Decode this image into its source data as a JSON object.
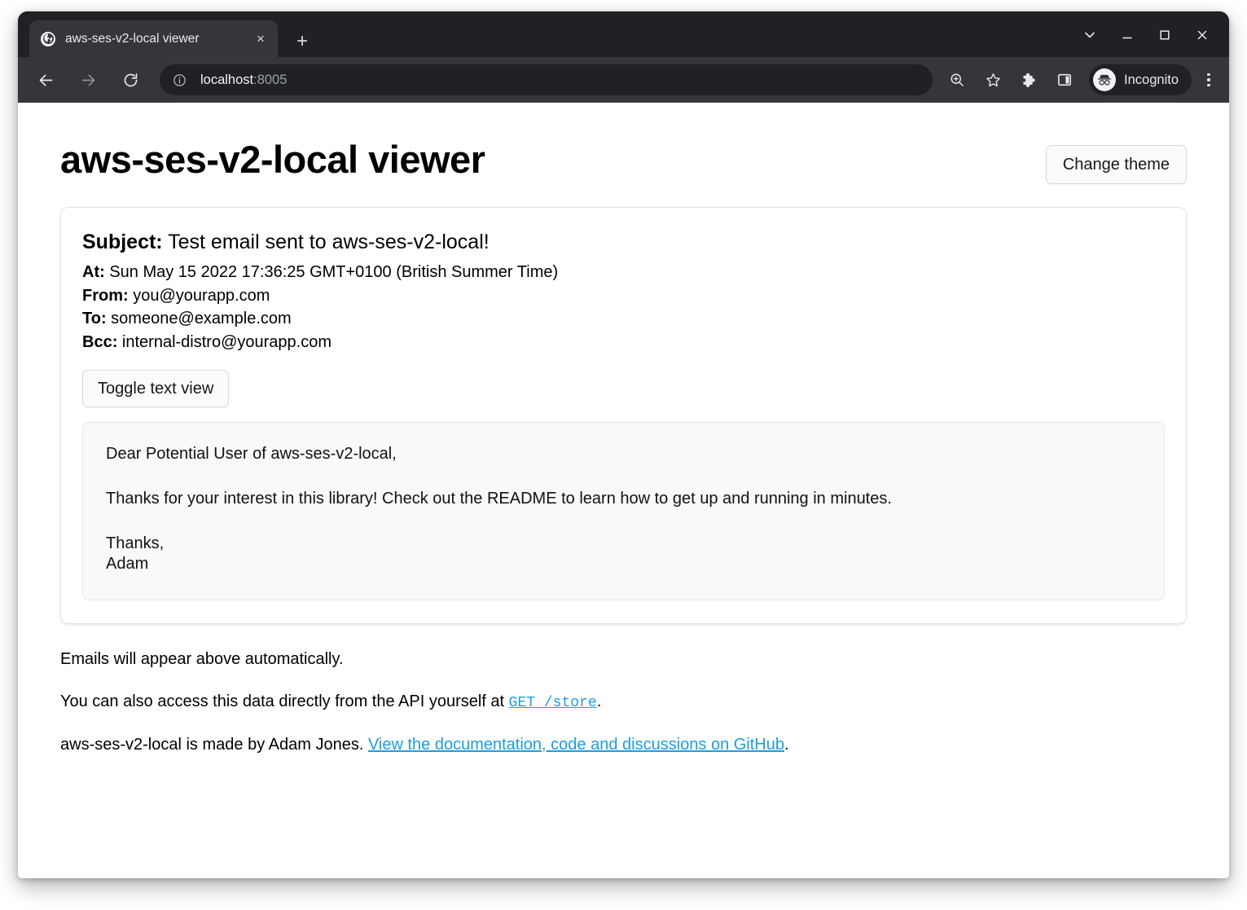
{
  "browser": {
    "tab": {
      "title": "aws-ses-v2-local viewer",
      "favicon": "globe-icon",
      "close_label": "×"
    },
    "new_tab_label": "+",
    "window_controls": {
      "tab_search": "chevron-down-icon",
      "minimize": "minimize-icon",
      "maximize": "maximize-icon",
      "close": "close-icon"
    },
    "toolbar": {
      "back": "back-arrow-icon",
      "forward": "forward-arrow-icon",
      "reload": "reload-icon",
      "site_info": "info-icon",
      "url_host": "localhost",
      "url_port": ":8005",
      "zoom": "zoom-in-icon",
      "bookmark": "star-icon",
      "extensions": "puzzle-piece-icon",
      "side_panel": "side-panel-icon",
      "profile_avatar": "incognito-avatar-icon",
      "profile_label": "Incognito",
      "menu": "three-dot-menu-icon"
    }
  },
  "page": {
    "title": "aws-ses-v2-local viewer",
    "change_theme_label": "Change theme",
    "email": {
      "subject_label": "Subject:",
      "subject_value": "Test email sent to aws-ses-v2-local!",
      "at_label": "At:",
      "at_value": "Sun May 15 2022 17:36:25 GMT+0100 (British Summer Time)",
      "from_label": "From:",
      "from_value": "you@yourapp.com",
      "to_label": "To:",
      "to_value": "someone@example.com",
      "bcc_label": "Bcc:",
      "bcc_value": "internal-distro@yourapp.com",
      "toggle_label": "Toggle text view",
      "body_paragraphs": [
        "Dear Potential User of aws-ses-v2-local,",
        "Thanks for your interest in this library! Check out the README to learn how to get up and running in minutes.",
        "Thanks,"
      ],
      "body_signature": "Adam"
    },
    "notes": {
      "auto_appear": "Emails will appear above automatically.",
      "api_prefix": "You can also access this data directly from the API yourself at ",
      "api_link": "GET /store",
      "api_suffix": ".",
      "credit_prefix": "aws-ses-v2-local is made by Adam Jones. ",
      "credit_link": "View the documentation, code and discussions on GitHub",
      "credit_suffix": "."
    }
  },
  "colors": {
    "link": "#1b9ee0",
    "titlebar": "#202124",
    "toolbar": "#35363a",
    "card_border": "#e2e4e7",
    "body_box": "#f8f9fa"
  }
}
